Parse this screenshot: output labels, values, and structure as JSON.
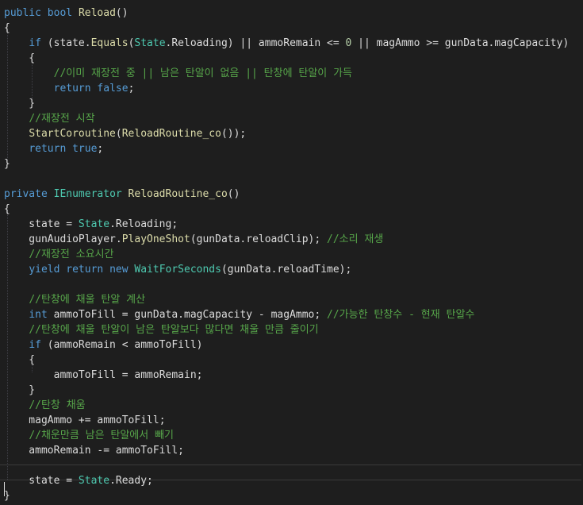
{
  "colors": {
    "background": "#1e1e1e",
    "plain": "#dcdcdc",
    "keyword": "#569cd6",
    "comment": "#57a64a",
    "type": "#4ec9b0",
    "method": "#dcdcaa",
    "number": "#b5cea8"
  },
  "code": {
    "lines": [
      [
        [
          "kw",
          "public"
        ],
        [
          "pl",
          " "
        ],
        [
          "kw",
          "bool"
        ],
        [
          "pl",
          " "
        ],
        [
          "fn",
          "Reload"
        ],
        [
          "pl",
          "()"
        ]
      ],
      [
        [
          "brkt",
          "{"
        ]
      ],
      [
        [
          "pl",
          "    "
        ],
        [
          "kw",
          "if"
        ],
        [
          "pl",
          " (state."
        ],
        [
          "fn",
          "Equals"
        ],
        [
          "pl",
          "("
        ],
        [
          "typ",
          "State"
        ],
        [
          "pl",
          ".Reloading) || ammoRemain <= "
        ],
        [
          "num",
          "0"
        ],
        [
          "pl",
          " || magAmmo >= gunData.magCapacity)"
        ]
      ],
      [
        [
          "pl",
          "    {"
        ]
      ],
      [
        [
          "pl",
          "        "
        ],
        [
          "cm",
          "//이미 재장전 중 || 남은 탄알이 없음 || 탄창에 탄알이 가득"
        ]
      ],
      [
        [
          "pl",
          "        "
        ],
        [
          "kw",
          "return"
        ],
        [
          "pl",
          " "
        ],
        [
          "kw",
          "false"
        ],
        [
          "pl",
          ";"
        ]
      ],
      [
        [
          "pl",
          "    }"
        ]
      ],
      [
        [
          "pl",
          "    "
        ],
        [
          "cm",
          "//재장전 시작"
        ]
      ],
      [
        [
          "pl",
          "    "
        ],
        [
          "fn",
          "StartCoroutine"
        ],
        [
          "pl",
          "("
        ],
        [
          "fn",
          "ReloadRoutine_co"
        ],
        [
          "pl",
          "());"
        ]
      ],
      [
        [
          "pl",
          "    "
        ],
        [
          "kw",
          "return"
        ],
        [
          "pl",
          " "
        ],
        [
          "kw",
          "true"
        ],
        [
          "pl",
          ";"
        ]
      ],
      [
        [
          "brkt",
          "}"
        ]
      ],
      [
        [
          "pl",
          ""
        ]
      ],
      [
        [
          "kw",
          "private"
        ],
        [
          "pl",
          " "
        ],
        [
          "typ",
          "IEnumerator"
        ],
        [
          "pl",
          " "
        ],
        [
          "fn",
          "ReloadRoutine_co"
        ],
        [
          "pl",
          "()"
        ]
      ],
      [
        [
          "brkt",
          "{"
        ]
      ],
      [
        [
          "pl",
          "    state = "
        ],
        [
          "typ",
          "State"
        ],
        [
          "pl",
          ".Reloading;"
        ]
      ],
      [
        [
          "pl",
          "    gunAudioPlayer."
        ],
        [
          "fn",
          "PlayOneShot"
        ],
        [
          "pl",
          "(gunData.reloadClip); "
        ],
        [
          "cm",
          "//소리 재생"
        ]
      ],
      [
        [
          "pl",
          "    "
        ],
        [
          "cm",
          "//재장전 소요시간"
        ]
      ],
      [
        [
          "pl",
          "    "
        ],
        [
          "kw",
          "yield"
        ],
        [
          "pl",
          " "
        ],
        [
          "kw",
          "return"
        ],
        [
          "pl",
          " "
        ],
        [
          "kw",
          "new"
        ],
        [
          "pl",
          " "
        ],
        [
          "typ",
          "WaitForSeconds"
        ],
        [
          "pl",
          "(gunData.reloadTime);"
        ]
      ],
      [
        [
          "pl",
          ""
        ]
      ],
      [
        [
          "pl",
          "    "
        ],
        [
          "cm",
          "//탄창에 채울 탄알 계산"
        ]
      ],
      [
        [
          "pl",
          "    "
        ],
        [
          "kw",
          "int"
        ],
        [
          "pl",
          " "
        ],
        [
          "fld",
          "ammoToFill"
        ],
        [
          "pl",
          " = gunData.magCapacity - magAmmo; "
        ],
        [
          "cm",
          "//가능한 탄창수 - 현재 탄알수"
        ]
      ],
      [
        [
          "pl",
          "    "
        ],
        [
          "cm",
          "//탄창에 채울 탄알이 남은 탄알보다 많다면 채울 만큼 줄이기"
        ]
      ],
      [
        [
          "pl",
          "    "
        ],
        [
          "kw",
          "if"
        ],
        [
          "pl",
          " (ammoRemain < "
        ],
        [
          "fld",
          "ammoToFill"
        ],
        [
          "pl",
          ")"
        ]
      ],
      [
        [
          "pl",
          "    {"
        ]
      ],
      [
        [
          "pl",
          "        "
        ],
        [
          "fld",
          "ammoToFill"
        ],
        [
          "pl",
          " = ammoRemain;"
        ]
      ],
      [
        [
          "pl",
          "    }"
        ]
      ],
      [
        [
          "pl",
          "    "
        ],
        [
          "cm",
          "//탄창 채움"
        ]
      ],
      [
        [
          "pl",
          "    magAmmo += "
        ],
        [
          "fld",
          "ammoToFill"
        ],
        [
          "pl",
          ";"
        ]
      ],
      [
        [
          "pl",
          "    "
        ],
        [
          "cm",
          "//채운만큼 남은 탄알에서 빼기"
        ]
      ],
      [
        [
          "pl",
          "    ammoRemain -= "
        ],
        [
          "fld",
          "ammoToFill"
        ],
        [
          "pl",
          ";"
        ]
      ],
      [
        [
          "pl",
          ""
        ]
      ],
      [
        [
          "pl",
          "    state = "
        ],
        [
          "typ",
          "State"
        ],
        [
          "pl",
          ".Ready;"
        ]
      ],
      [
        [
          "brkt",
          "}"
        ]
      ]
    ]
  }
}
